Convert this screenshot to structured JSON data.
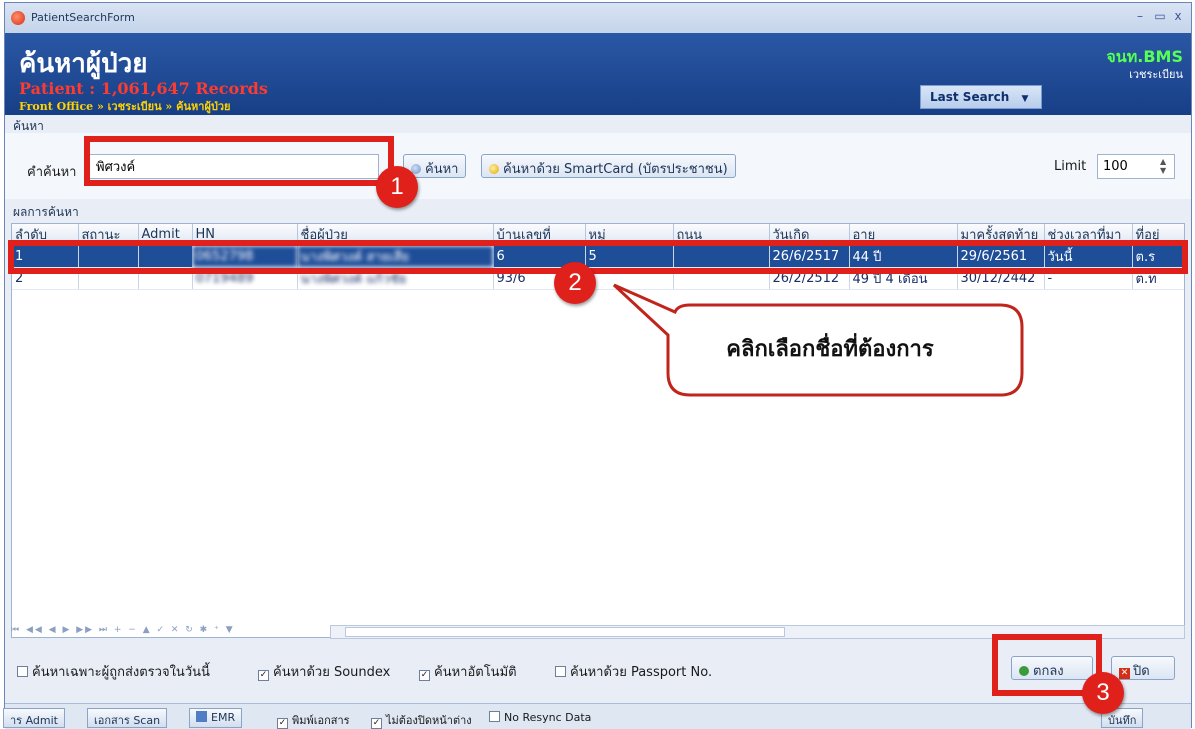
{
  "window": {
    "title": "PatientSearchForm",
    "controls": [
      "–",
      "▭",
      "x"
    ]
  },
  "header": {
    "title": "ค้นหาผู้ป่วย",
    "records": "Patient : 1,061,647 Records",
    "breadcrumb": "Front Office » เวชระเบียน » ค้นหาผู้ป่วย",
    "brand": "จนท.BMS",
    "brand_sub": "เวชระเบียน",
    "last_search": "Last Search"
  },
  "search": {
    "section_label": "ค้นหา",
    "field_label": "คำค้นหา",
    "query": "พิศวงค์",
    "search_button": "ค้นหา",
    "smartcard_button": "ค้นหาด้วย SmartCard (บัตรประชาชน)",
    "limit_label": "Limit",
    "limit_value": "100"
  },
  "results": {
    "section_label": "ผลการค้นหา",
    "columns": [
      "ลำดับ",
      "สถานะ",
      "Admit",
      "HN",
      "ชื่อผู้ป่วย",
      "บ้านเลขที่",
      "หมู่",
      "ถนน",
      "วันเกิด",
      "อายุ",
      "มาครั้งสุดท้าย",
      "ช่วงเวลาที่มา",
      "ที่อยู่"
    ],
    "rows": [
      [
        "1",
        "",
        "",
        "0652798",
        "นางพิศวงค์ สายเสีย",
        "6",
        "5",
        "",
        "26/6/2517",
        "44 ปี",
        "29/6/2561",
        "วันนี้",
        "ต.ร"
      ],
      [
        "2",
        "",
        "",
        "0719489",
        "นางพิศวงค์ แก้วชัย",
        "93/6",
        "",
        "",
        "26/2/2512",
        "49 ปี 4 เดือน",
        "30/12/2442",
        "-",
        "ต.ท"
      ]
    ],
    "selected_row": 0
  },
  "annotations": {
    "badges": [
      "1",
      "2",
      "3"
    ],
    "callout": "คลิกเลือกชื่อที่ต้องการ"
  },
  "options": {
    "today_only": "ค้นหาเฉพาะผู้ถูกส่งตรวจในวันนี้",
    "soundex": "ค้นหาด้วย Soundex",
    "auto": "ค้นหาอัตโนมัติ",
    "passport": "ค้นหาด้วย Passport No.",
    "ok_button": "ตกลง",
    "close_button": "ปิด"
  },
  "footer": {
    "admit": "าร Admit",
    "scan": "เอกสาร Scan",
    "emr": "EMR",
    "print_docs": "พิมพ์เอกสาร",
    "no_close": "ไม่ต้องปิดหน้าต่าง",
    "no_resync": "No Resync Data",
    "note": "บันทึก"
  },
  "colors": {
    "header": "#1f4a96",
    "selection": "#1f4e99",
    "annotation": "#e0201b"
  }
}
